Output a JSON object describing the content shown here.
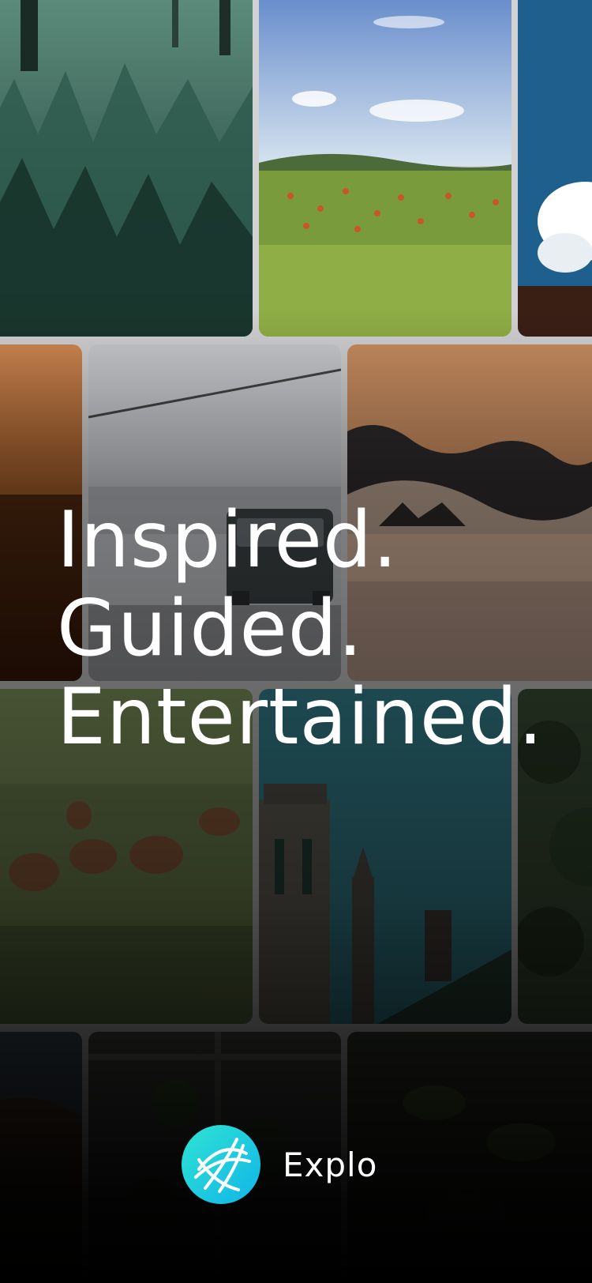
{
  "headline": {
    "line1": "Inspired.",
    "line2": "Guided.",
    "line3": "Entertained."
  },
  "brand": {
    "name": "Explo",
    "logo_icon": "globe-icon",
    "logo_colors": [
      "#2fe3d3",
      "#10b6e8"
    ]
  },
  "gallery": {
    "tiles": [
      "forest-grass",
      "flower-field",
      "blue-sky-clouds",
      "sunset-field",
      "foggy-road-car",
      "misty-hills",
      "chickens-on-grass",
      "gothic-church",
      "dark-trees",
      "dark-landscape",
      "window-plants",
      "dark-leaves"
    ]
  }
}
